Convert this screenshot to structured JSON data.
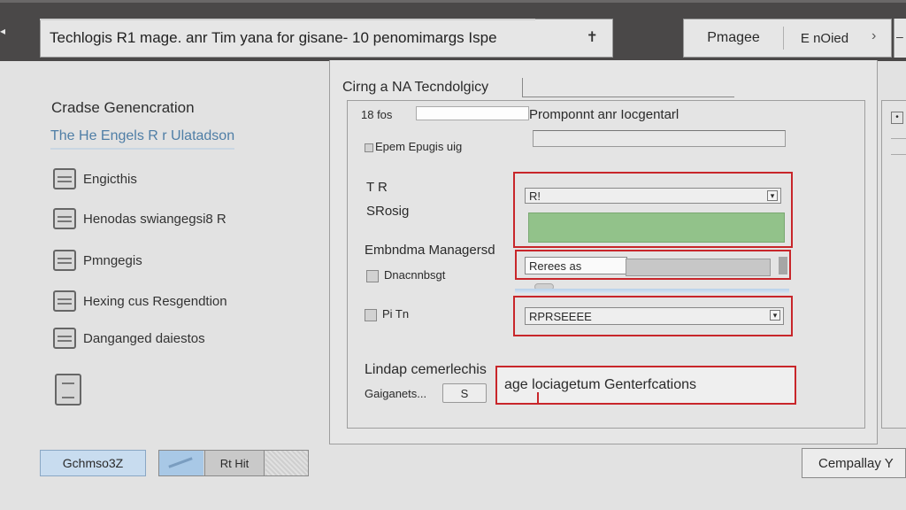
{
  "header": {
    "title": "Techlogis R1 mage. anr Tim yana for gisane- 10 penomimargs Ispe",
    "tabs": [
      "Pmagee",
      "E nOied"
    ],
    "left_glyph": "◂",
    "right_glyph": "‒"
  },
  "sidebar": {
    "title": "Cradse Genencration",
    "subtitle": "The He Engels R r Ulatadson",
    "items": [
      {
        "label": "Engicthis",
        "icon": "layers-icon"
      },
      {
        "label": "Henodas swiangegsi8 R",
        "icon": "image-icon"
      },
      {
        "label": "Pmngegis",
        "icon": "folder-icon"
      },
      {
        "label": "Hexing cus Resgendtion",
        "icon": "document-icon"
      },
      {
        "label": "Danganged daiestos",
        "icon": "list-icon"
      }
    ]
  },
  "bottom_left": {
    "primary_button": "Gchmso3Z",
    "segment_label": "Rt Hit"
  },
  "main": {
    "title": "Cirng a NA Tecndolgicy",
    "row1_label": "18 fos",
    "prompt_text": "Promponnt anr Iocgentarl",
    "row2_label": "Epem Epugis uig",
    "row3_label": "T R",
    "row3b_label": "SRosig",
    "field1_text": "R!",
    "row4_label": "Embndma Managersd",
    "row4b_label": "Dnacnnbsgt",
    "field2_text": "Rerees as",
    "row5_label": "Pi Tn",
    "field3_text": "RPRSEEEE",
    "row6_label": "Lindap cemerlechis",
    "row6b_label": "Gaiganets...",
    "small_button": "S",
    "gen_field_text": "age lociagetum Genterfcations"
  },
  "footer": {
    "action_button": "Cempallay Y"
  },
  "colors": {
    "topbar": "#4a4848",
    "highlight_red": "#c8262a",
    "progress_green": "#92c28a",
    "accent_blue": "#c8dcef"
  }
}
